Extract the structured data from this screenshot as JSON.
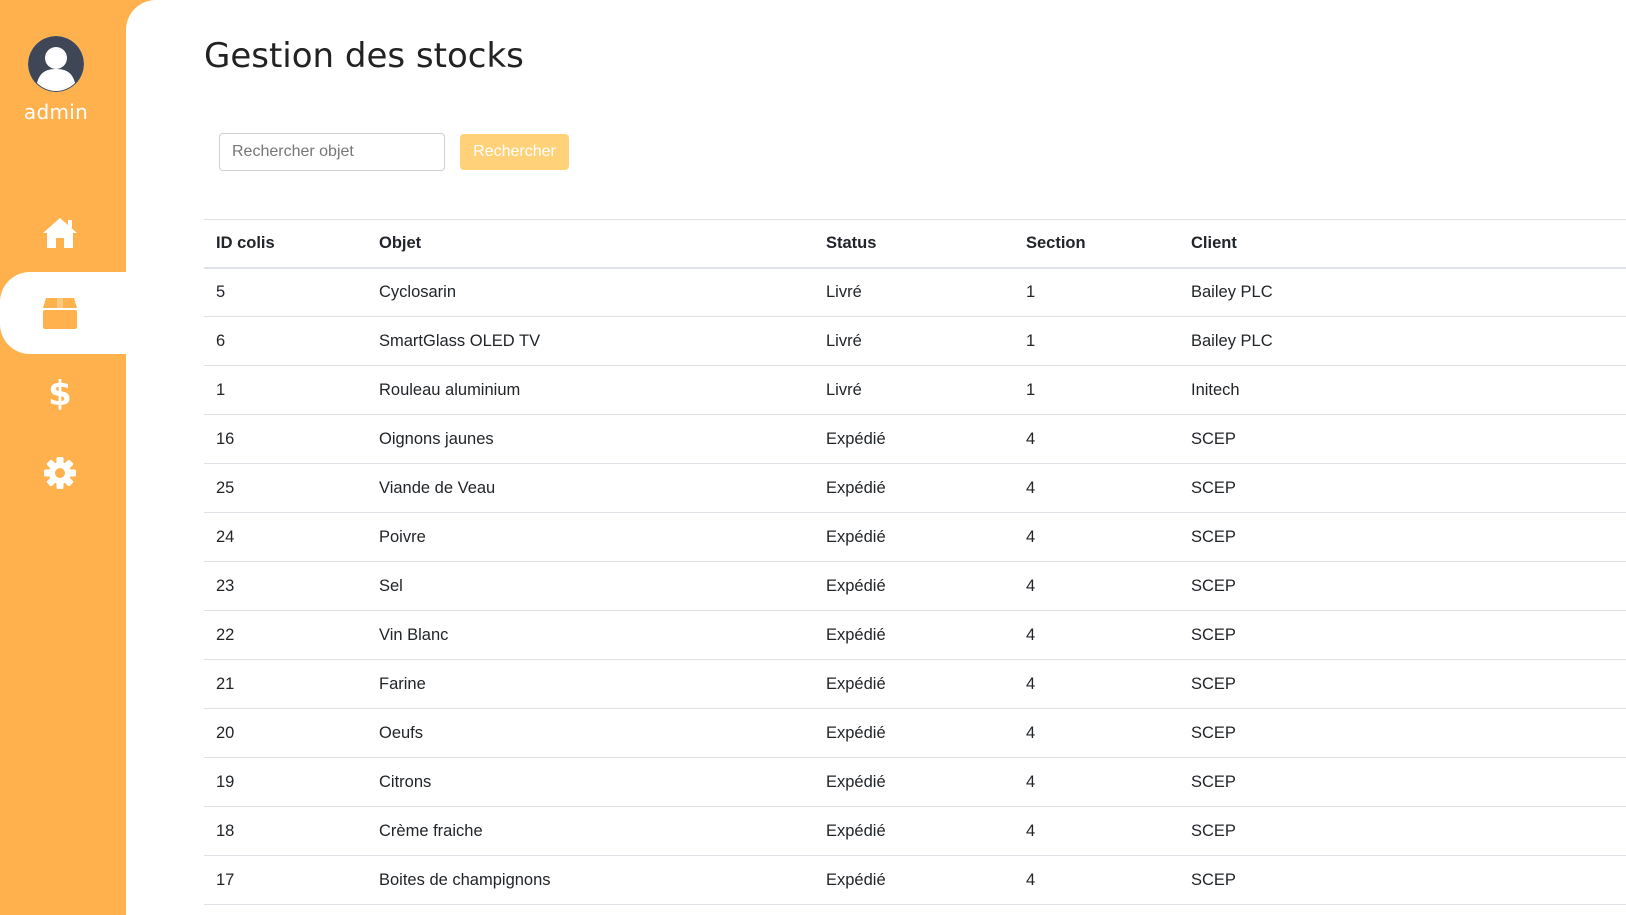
{
  "colors": {
    "sidebar": "#FFB14D",
    "accent_button": "#FFD27A",
    "content_bg": "#FFFFFF"
  },
  "user": {
    "name": "admin",
    "avatar_icon": "user-avatar-icon"
  },
  "nav": [
    {
      "icon": "home-icon",
      "active": false
    },
    {
      "icon": "box-icon",
      "active": true
    },
    {
      "icon": "dollar-icon",
      "active": false
    },
    {
      "icon": "gear-icon",
      "active": false
    }
  ],
  "page": {
    "title": "Gestion des stocks"
  },
  "search": {
    "placeholder": "Rechercher objet",
    "value": "",
    "button_label": "Rechercher"
  },
  "table": {
    "headers": [
      "ID colis",
      "Objet",
      "Status",
      "Section",
      "Client"
    ],
    "rows": [
      [
        "5",
        "Cyclosarin",
        "Livré",
        "1",
        "Bailey PLC"
      ],
      [
        "6",
        "SmartGlass OLED TV",
        "Livré",
        "1",
        "Bailey PLC"
      ],
      [
        "1",
        "Rouleau aluminium",
        "Livré",
        "1",
        "Initech"
      ],
      [
        "16",
        "Oignons jaunes",
        "Expédié",
        "4",
        "SCEP"
      ],
      [
        "25",
        "Viande de Veau",
        "Expédié",
        "4",
        "SCEP"
      ],
      [
        "24",
        "Poivre",
        "Expédié",
        "4",
        "SCEP"
      ],
      [
        "23",
        "Sel",
        "Expédié",
        "4",
        "SCEP"
      ],
      [
        "22",
        "Vin Blanc",
        "Expédié",
        "4",
        "SCEP"
      ],
      [
        "21",
        "Farine",
        "Expédié",
        "4",
        "SCEP"
      ],
      [
        "20",
        "Oeufs",
        "Expédié",
        "4",
        "SCEP"
      ],
      [
        "19",
        "Citrons",
        "Expédié",
        "4",
        "SCEP"
      ],
      [
        "18",
        "Crème fraiche",
        "Expédié",
        "4",
        "SCEP"
      ],
      [
        "17",
        "Boites de champignons",
        "Expédié",
        "4",
        "SCEP"
      ]
    ]
  }
}
